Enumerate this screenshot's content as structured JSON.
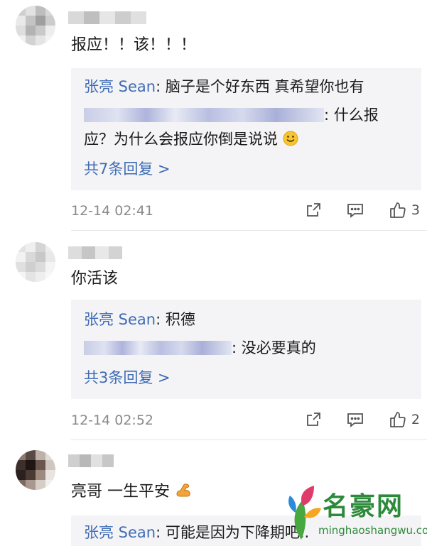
{
  "comments": [
    {
      "text": "报应！！该！！！",
      "replies": [
        {
          "author": "张亮 Sean",
          "text": ": 脑子是个好东西 真希望你也有"
        },
        {
          "author": "",
          "text": ": 什么报"
        },
        {
          "author": "",
          "text": "应？为什么会报应你倒是说说"
        }
      ],
      "more_label": "共7条回复 >",
      "time": "12-14 02:41",
      "likes": "3"
    },
    {
      "text": "你活该",
      "replies": [
        {
          "author": "张亮 Sean",
          "text": ": 积德"
        },
        {
          "author": "",
          "text": ": 没必要真的"
        }
      ],
      "more_label": "共3条回复 >",
      "time": "12-14 02:52",
      "likes": "2"
    },
    {
      "text": "亮哥 一生平安",
      "replies": [
        {
          "author": "张亮 Sean",
          "text": ": 可能是因为下降期吧.."
        }
      ]
    }
  ],
  "icons": {
    "share": "share-icon",
    "reply": "comment-icon",
    "like": "thumbs-up-icon",
    "smile": "smile-emoji-icon",
    "muscle": "flexed-biceps-emoji-icon"
  },
  "colors": {
    "author_blue": "#3e6bb5",
    "reply_bg": "#f4f4f6",
    "meta_gray": "#8a8a8a",
    "watermark_green": "#2d8a3a"
  },
  "watermark": {
    "title": "名豪网",
    "url": "minghaoshangwu.com"
  }
}
